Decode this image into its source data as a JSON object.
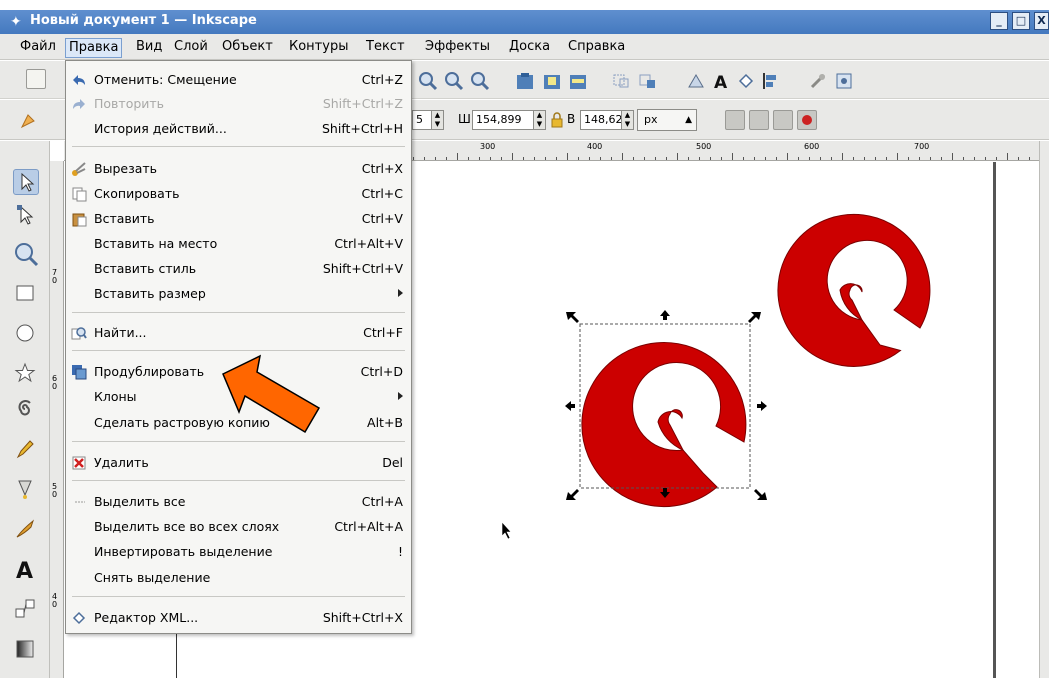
{
  "window": {
    "title": "Новый документ 1 — Inkscape",
    "buttons": {
      "minimize": "_",
      "maximize": "□",
      "close": "X"
    }
  },
  "menubar": [
    {
      "label": "Файл"
    },
    {
      "label": "Правка"
    },
    {
      "label": "Вид"
    },
    {
      "label": "Слой"
    },
    {
      "label": "Объект"
    },
    {
      "label": "Контуры"
    },
    {
      "label": "Текст"
    },
    {
      "label": "Эффекты"
    },
    {
      "label": "Доска"
    },
    {
      "label": "Справка"
    }
  ],
  "active_menu": "Правка",
  "edit_menu": [
    {
      "label": "Отменить: Смещение",
      "shortcut": "Ctrl+Z",
      "icon": "undo-icon",
      "disabled": false
    },
    {
      "label": "Повторить",
      "shortcut": "Shift+Ctrl+Z",
      "icon": "redo-icon",
      "disabled": true
    },
    {
      "label": "История действий...",
      "shortcut": "Shift+Ctrl+H",
      "icon": "",
      "disabled": false
    },
    {
      "label": "Вырезать",
      "shortcut": "Ctrl+X",
      "icon": "cut-icon",
      "disabled": false
    },
    {
      "label": "Скопировать",
      "shortcut": "Ctrl+C",
      "icon": "copy-icon",
      "disabled": false
    },
    {
      "label": "Вставить",
      "shortcut": "Ctrl+V",
      "icon": "paste-icon",
      "disabled": false
    },
    {
      "label": "Вставить на место",
      "shortcut": "Ctrl+Alt+V",
      "icon": "",
      "disabled": false
    },
    {
      "label": "Вставить стиль",
      "shortcut": "Shift+Ctrl+V",
      "icon": "",
      "disabled": false
    },
    {
      "label": "Вставить размер",
      "shortcut": "",
      "icon": "",
      "disabled": false,
      "submenu": true
    },
    {
      "label": "Найти...",
      "shortcut": "Ctrl+F",
      "icon": "find-icon",
      "disabled": false
    },
    {
      "label": "Продублировать",
      "shortcut": "Ctrl+D",
      "icon": "duplicate-icon",
      "disabled": false
    },
    {
      "label": "Клоны",
      "shortcut": "",
      "icon": "",
      "disabled": false,
      "submenu": true
    },
    {
      "label": "Сделать растровую копию",
      "shortcut": "Alt+B",
      "icon": "",
      "disabled": false
    },
    {
      "label": "Удалить",
      "shortcut": "Del",
      "icon": "delete-icon",
      "disabled": false
    },
    {
      "label": "Выделить все",
      "shortcut": "Ctrl+A",
      "icon": "select-all-icon",
      "disabled": false
    },
    {
      "label": "Выделить все во всех слоях",
      "shortcut": "Ctrl+Alt+A",
      "icon": "",
      "disabled": false
    },
    {
      "label": "Инвертировать выделение",
      "shortcut": "!",
      "icon": "",
      "disabled": false
    },
    {
      "label": "Снять выделение",
      "shortcut": "",
      "icon": "",
      "disabled": false
    },
    {
      "label": "Редактор XML...",
      "shortcut": "Shift+Ctrl+X",
      "icon": "xml-editor-icon",
      "disabled": false
    }
  ],
  "toolbar2": {
    "x_value": "5",
    "w_label": "Ш",
    "w_value": "154,899",
    "h_label": "В",
    "h_value": "148,620",
    "unit": "px"
  },
  "ruler": {
    "labels": [
      "300",
      "400",
      "500",
      "600",
      "700"
    ]
  },
  "vruler_labels": [
    "7",
    "0",
    "6",
    "0",
    "5",
    "0",
    "4",
    "0"
  ],
  "colors": {
    "spiral_fill": "#cc0000",
    "titlebar": "#4a7fc4",
    "arrow_fill": "#ff6600",
    "menu_active": "#dbe8f8"
  }
}
